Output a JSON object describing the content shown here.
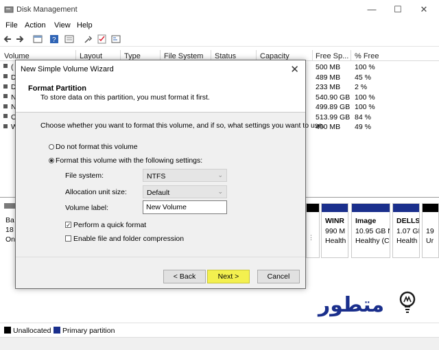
{
  "window": {
    "title": "Disk Management",
    "minimize": "—",
    "maximize": "☐",
    "close": "✕"
  },
  "menu": [
    "File",
    "Action",
    "View",
    "Help"
  ],
  "columns": [
    "Volume",
    "Layout",
    "Type",
    "File System",
    "Status",
    "Capacity",
    "Free Sp...",
    "% Free"
  ],
  "rows": [
    {
      "vol": "(",
      "free": "500 MB",
      "pct": "100 %"
    },
    {
      "vol": "D",
      "free": "489 MB",
      "pct": "45 %"
    },
    {
      "vol": "D",
      "free": "233 MB",
      "pct": "2 %"
    },
    {
      "vol": "N",
      "free": "540.90 GB",
      "pct": "100 %"
    },
    {
      "vol": "N",
      "free": "499.89 GB",
      "pct": "100 %"
    },
    {
      "vol": "O",
      "free": "513.99 GB",
      "pct": "84 %"
    },
    {
      "vol": "W",
      "free": "490 MB",
      "pct": "49 %"
    }
  ],
  "disk": {
    "name": "Ba",
    "size": "18",
    "status": "On"
  },
  "partitions": [
    {
      "t1": "WINR",
      "t2": "990 M",
      "t3": "Health"
    },
    {
      "t1": "Image",
      "t2": "10.95 GB N",
      "t3": "Healthy (C"
    },
    {
      "t1": "DELLS",
      "t2": "1.07 GI",
      "t3": "Health"
    },
    {
      "t1": "",
      "t2": "19",
      "t3": "Ur"
    }
  ],
  "legend": {
    "unallocated": "Unallocated",
    "primary": "Primary partition"
  },
  "colors": {
    "unallocated": "#000000",
    "primary": "#1a2f8c",
    "next_highlight": "#f3f04f"
  },
  "watermark": {
    "text": "متطور"
  },
  "dialog": {
    "title": "New Simple Volume Wizard",
    "close": "✕",
    "header": "Format Partition",
    "subheader": "To store data on this partition, you must format it first.",
    "question": "Choose whether you want to format this volume, and if so, what settings you want to use.",
    "option_no_format": "Do not format this volume",
    "option_format": "Format this volume with the following settings:",
    "fs_label": "File system:",
    "fs_value": "NTFS",
    "alloc_label": "Allocation unit size:",
    "alloc_value": "Default",
    "vol_label": "Volume label:",
    "vol_value": "New Volume",
    "quick_format": "Perform a quick format",
    "compression": "Enable file and folder compression",
    "back": "< Back",
    "next": "Next >",
    "cancel": "Cancel"
  }
}
